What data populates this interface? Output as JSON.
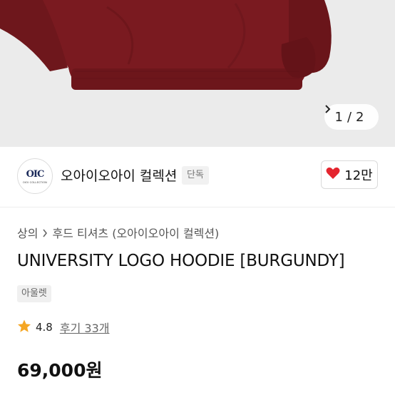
{
  "gallery": {
    "current_page": "1",
    "separator": "/",
    "total_pages": "2",
    "product_color": "#7a1a20"
  },
  "brand": {
    "logo_mark": "OIC",
    "logo_sub": "OIOI COLLECTION",
    "name": "오아이오아이 컬렉션",
    "exclusive_badge": "단독",
    "like_count": "12만"
  },
  "product": {
    "breadcrumb": [
      "상의",
      "후드 티셔츠 (오아이오아이 컬렉션)"
    ],
    "title": "UNIVERSITY LOGO HOODIE [BURGUNDY]",
    "tag": "아울렛",
    "rating": "4.8",
    "reviews": "후기 33개",
    "price": "69,000원"
  },
  "colors": {
    "heart": "#e4252f",
    "star": "#f5a623"
  }
}
